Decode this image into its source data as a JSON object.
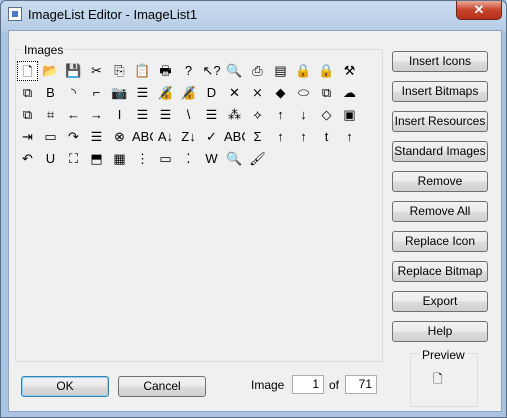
{
  "window": {
    "title": "ImageList Editor - ImageList1",
    "close": "✕"
  },
  "group": {
    "label": "Images"
  },
  "icons": [
    [
      "🗋",
      "📂",
      "💾",
      "✂",
      "⎘",
      "📋",
      "🖶",
      "?",
      "↖?",
      "🔍",
      "⎙",
      "▤",
      "🔒",
      "🔒",
      "⚒"
    ],
    [
      "⧉",
      "B",
      "◝",
      "⌐",
      "📷",
      "☰",
      "🔏",
      "🔏",
      "D",
      "✕",
      "⨯",
      "◆",
      "⬭",
      "⧉",
      "☁"
    ],
    [
      "⧉",
      "⌗",
      "←",
      "→",
      "I",
      "☰",
      "☰",
      "\\",
      "☰",
      "⁂",
      "⟡",
      "↑",
      "↓",
      "◇",
      "▣"
    ],
    [
      "⇥",
      "▭",
      "↷",
      "☰",
      "⊗",
      "ABC",
      "A↓",
      "Z↓",
      "✓",
      "ABC",
      "Σ",
      "↑",
      "↑",
      "t",
      "↑"
    ],
    [
      "↶",
      "U",
      "⛶",
      "⬒",
      "▦",
      "⋮",
      "▭",
      "⁚",
      "W",
      "🔍",
      "🖌"
    ]
  ],
  "buttons": {
    "insert_icons": "Insert Icons",
    "insert_bitmaps": "Insert Bitmaps",
    "insert_resources": "Insert Resources",
    "standard_images": "Standard Images",
    "remove": "Remove",
    "remove_all": "Remove All",
    "replace_icon": "Replace Icon",
    "replace_bitmap": "Replace Bitmap",
    "export": "Export",
    "help": "Help",
    "ok": "OK",
    "cancel": "Cancel"
  },
  "preview": {
    "label": "Preview",
    "icon": "🗋"
  },
  "image_nav": {
    "label": "Image",
    "current": "1",
    "of_label": "of",
    "total": "71"
  }
}
